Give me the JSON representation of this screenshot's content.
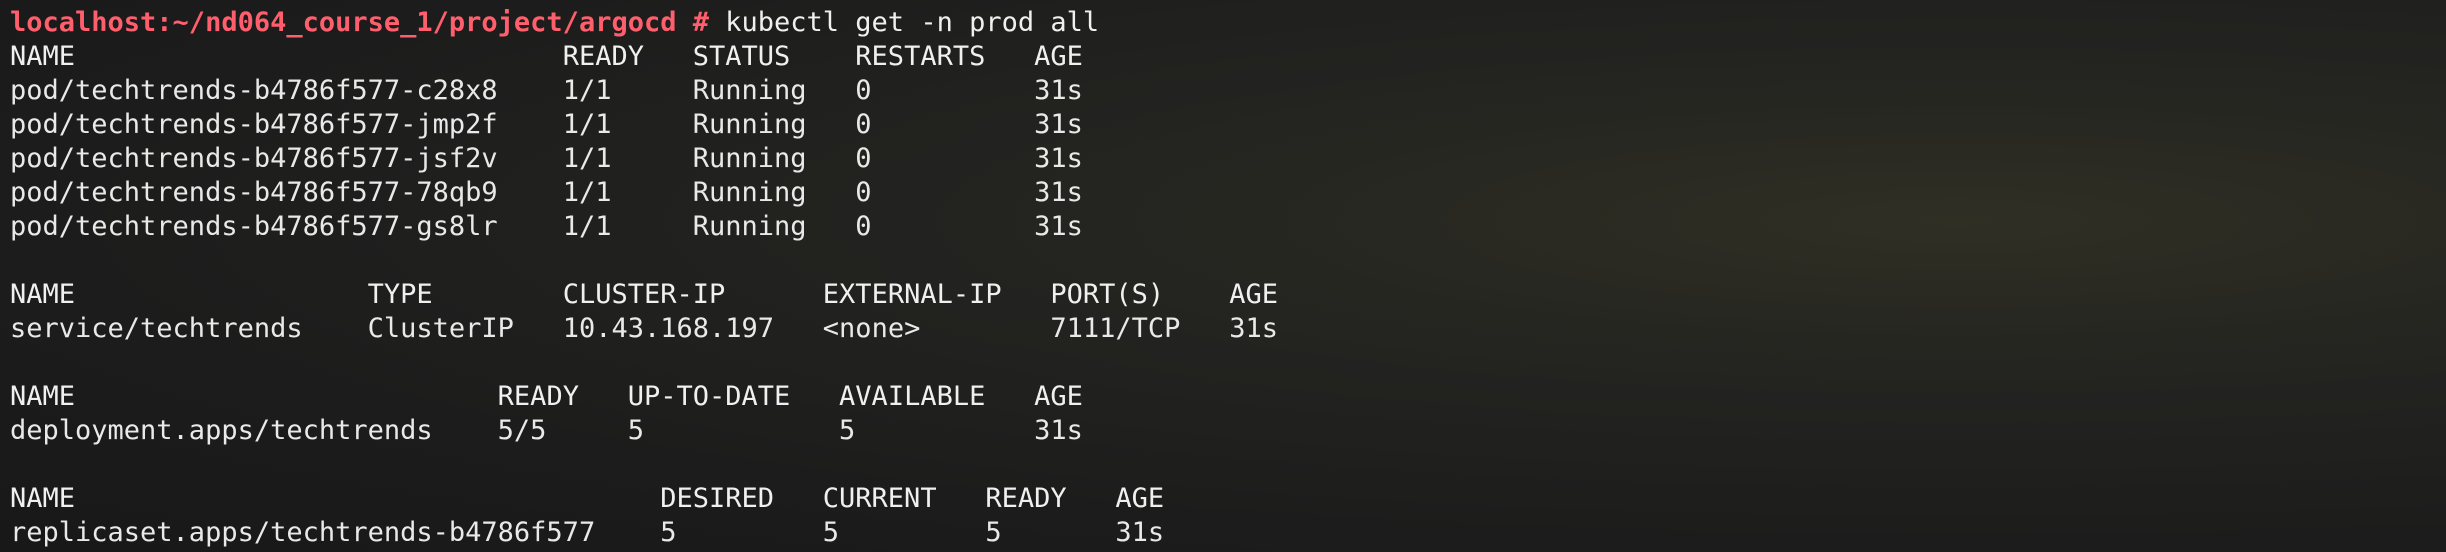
{
  "terminal": {
    "prompt": "localhost:~/nd064_course_1/project/argocd # ",
    "command": "kubectl get -n prod all"
  },
  "pods": {
    "headers": [
      "NAME",
      "READY",
      "STATUS",
      "RESTARTS",
      "AGE"
    ],
    "rows": [
      [
        "pod/techtrends-b4786f577-c28x8",
        "1/1",
        "Running",
        "0",
        "31s"
      ],
      [
        "pod/techtrends-b4786f577-jmp2f",
        "1/1",
        "Running",
        "0",
        "31s"
      ],
      [
        "pod/techtrends-b4786f577-jsf2v",
        "1/1",
        "Running",
        "0",
        "31s"
      ],
      [
        "pod/techtrends-b4786f577-78qb9",
        "1/1",
        "Running",
        "0",
        "31s"
      ],
      [
        "pod/techtrends-b4786f577-gs8lr",
        "1/1",
        "Running",
        "0",
        "31s"
      ]
    ]
  },
  "services": {
    "headers": [
      "NAME",
      "TYPE",
      "CLUSTER-IP",
      "EXTERNAL-IP",
      "PORT(S)",
      "AGE"
    ],
    "rows": [
      [
        "service/techtrends",
        "ClusterIP",
        "10.43.168.197",
        "<none>",
        "7111/TCP",
        "31s"
      ]
    ]
  },
  "deployments": {
    "headers": [
      "NAME",
      "READY",
      "UP-TO-DATE",
      "AVAILABLE",
      "AGE"
    ],
    "rows": [
      [
        "deployment.apps/techtrends",
        "5/5",
        "5",
        "5",
        "31s"
      ]
    ]
  },
  "replicasets": {
    "headers": [
      "NAME",
      "DESIRED",
      "CURRENT",
      "READY",
      "AGE"
    ],
    "rows": [
      [
        "replicaset.apps/techtrends-b4786f577",
        "5",
        "5",
        "5",
        "31s"
      ]
    ]
  }
}
